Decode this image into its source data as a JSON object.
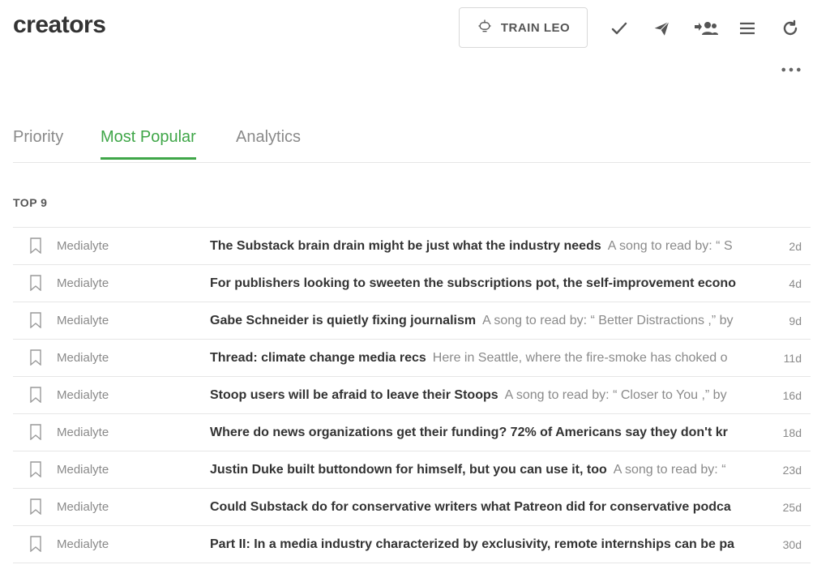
{
  "header": {
    "title": "creators",
    "train_button_label": "TRAIN LEO"
  },
  "toolbar": {
    "icons": [
      "check-icon",
      "send-icon",
      "share-with-team-icon",
      "menu-icon",
      "refresh-icon",
      "more-icon"
    ]
  },
  "tabs": [
    {
      "label": "Priority",
      "active": false
    },
    {
      "label": "Most Popular",
      "active": true
    },
    {
      "label": "Analytics",
      "active": false
    }
  ],
  "section": {
    "label": "TOP 9"
  },
  "colors": {
    "accent": "#3fa648",
    "muted": "#8a8a8a",
    "text": "#333333"
  },
  "articles": [
    {
      "source": "Medialyte",
      "headline": "The Substack brain drain might be just what the industry needs",
      "snippet": "A song to read by: “ S",
      "age": "2d"
    },
    {
      "source": "Medialyte",
      "headline": "For publishers looking to sweeten the subscriptions pot, the self-improvement econo",
      "snippet": "",
      "age": "4d"
    },
    {
      "source": "Medialyte",
      "headline": "Gabe Schneider is quietly fixing journalism",
      "snippet": "A song to read by: “ Better Distractions ,” by",
      "age": "9d"
    },
    {
      "source": "Medialyte",
      "headline": "Thread: climate change media recs",
      "snippet": "Here in Seattle, where the fire-smoke has choked o",
      "age": "11d"
    },
    {
      "source": "Medialyte",
      "headline": "Stoop users will be afraid to leave their Stoops",
      "snippet": "A song to read by: “ Closer to You ,” by",
      "age": "16d"
    },
    {
      "source": "Medialyte",
      "headline": "Where do news organizations get their funding? 72% of Americans say they don't kr",
      "snippet": "",
      "age": "18d"
    },
    {
      "source": "Medialyte",
      "headline": "Justin Duke built buttondown for himself, but you can use it, too",
      "snippet": "A song to read by: “",
      "age": "23d"
    },
    {
      "source": "Medialyte",
      "headline": "Could Substack do for conservative writers what Patreon did for conservative podca",
      "snippet": "",
      "age": "25d"
    },
    {
      "source": "Medialyte",
      "headline": "Part II: In a media industry characterized by exclusivity, remote internships can be pa",
      "snippet": "",
      "age": "30d"
    }
  ]
}
